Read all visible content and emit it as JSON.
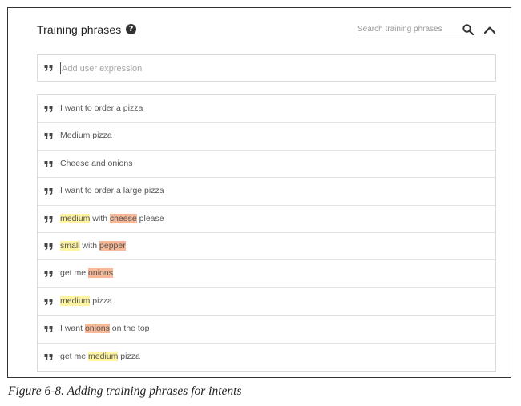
{
  "panel": {
    "title": "Training phrases",
    "help_icon": "help-circle-icon",
    "search_placeholder": "Search training phrases",
    "search_icon": "search-icon",
    "collapse_icon": "chevron-up-icon"
  },
  "add_expression": {
    "placeholder": "Add user expression",
    "icon": "quote-icon"
  },
  "phrases": [
    {
      "segments": [
        {
          "text": "I want to order a pizza",
          "hl": ""
        }
      ]
    },
    {
      "segments": [
        {
          "text": "Medium pizza",
          "hl": ""
        }
      ]
    },
    {
      "segments": [
        {
          "text": "Cheese and onions",
          "hl": ""
        }
      ]
    },
    {
      "segments": [
        {
          "text": "I want to order a large pizza",
          "hl": ""
        }
      ]
    },
    {
      "segments": [
        {
          "text": "medium",
          "hl": "yellow"
        },
        {
          "text": " with ",
          "hl": ""
        },
        {
          "text": "cheese",
          "hl": "orange"
        },
        {
          "text": " please",
          "hl": ""
        }
      ]
    },
    {
      "segments": [
        {
          "text": "small",
          "hl": "yellow"
        },
        {
          "text": " with ",
          "hl": ""
        },
        {
          "text": "pepper",
          "hl": "orange"
        }
      ]
    },
    {
      "segments": [
        {
          "text": "get me ",
          "hl": ""
        },
        {
          "text": "onions",
          "hl": "orange"
        }
      ]
    },
    {
      "segments": [
        {
          "text": "medium",
          "hl": "yellow"
        },
        {
          "text": " pizza",
          "hl": ""
        }
      ]
    },
    {
      "segments": [
        {
          "text": "I want ",
          "hl": ""
        },
        {
          "text": "onions",
          "hl": "orange"
        },
        {
          "text": " on the top",
          "hl": ""
        }
      ]
    },
    {
      "segments": [
        {
          "text": "get me ",
          "hl": ""
        },
        {
          "text": "medium",
          "hl": "yellow"
        },
        {
          "text": " pizza",
          "hl": ""
        }
      ]
    }
  ],
  "highlight_colors": {
    "yellow": "#fef3a0",
    "orange": "#f6b896"
  },
  "caption": "Figure 6-8. Adding training phrases for intents"
}
